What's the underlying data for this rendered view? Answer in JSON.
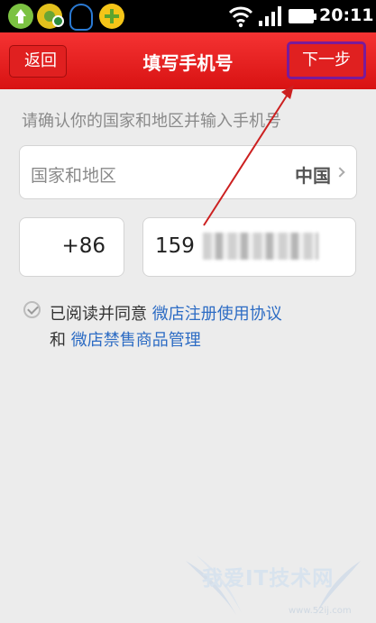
{
  "status_bar": {
    "icons": [
      "update-icon",
      "app-wheel-icon",
      "qq-icon",
      "plus-icon",
      "wifi-icon",
      "signal-icon",
      "battery-icon"
    ],
    "time": "20:11"
  },
  "title_bar": {
    "back_label": "返回",
    "title": "填写手机号",
    "next_label": "下一步",
    "accent_color": "#e02020",
    "highlight_color": "#7a1a9a"
  },
  "form": {
    "hint": "请确认你的国家和地区并输入手机号",
    "country_label": "国家和地区",
    "country_value": "中国",
    "country_code": "+86",
    "phone_value": "159"
  },
  "agreement": {
    "checked": true,
    "prefix": "已阅读并同意",
    "link1": "微店注册使用协议",
    "connector": "和",
    "link2": "微店禁售商品管理",
    "link_color": "#2d6cc4"
  },
  "watermark": {
    "text": "我爱IT技术网",
    "url": "www.52ij.com"
  }
}
